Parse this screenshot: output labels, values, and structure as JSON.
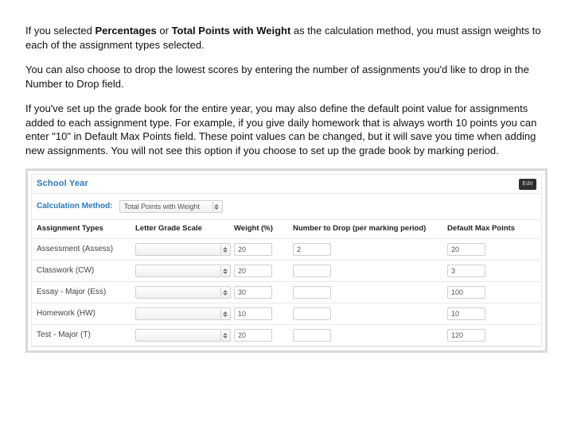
{
  "intro": {
    "p1_a": "If you selected ",
    "p1_b": "Percentages",
    "p1_c": " or ",
    "p1_d": "Total Points with Weight",
    "p1_e": " as the calculation method, you must assign weights to each of the assignment types selected.",
    "p2": "You can also choose to drop the lowest scores by entering the number of assignments you'd like to drop in the Number to Drop field.",
    "p3": "If you've set up the grade book for the entire year, you may also define the default point value for assignments added to each assignment type. For example, if you give daily homework that is always worth 10 points you can enter \"10\" in Default Max Points field. These point values can be changed, but it will save you time when adding new assignments. You will not see this option if you choose to set up the grade book by marking period."
  },
  "panel": {
    "title": "School Year",
    "edit": "Edit",
    "method_label": "Calculation Method:",
    "method_value": "Total Points with Weight",
    "headers": {
      "types": "Assignment Types",
      "scale": "Letter Grade Scale",
      "weight": "Weight (%)",
      "drop": "Number to Drop (per marking period)",
      "default": "Default Max Points"
    },
    "rows": [
      {
        "type": "Assessment (Assess)",
        "scale": "",
        "weight": "20",
        "drop": "2",
        "default": "20"
      },
      {
        "type": "Classwork (CW)",
        "scale": "",
        "weight": "20",
        "drop": "",
        "default": "3"
      },
      {
        "type": "Essay - Major (Ess)",
        "scale": "",
        "weight": "30",
        "drop": "",
        "default": "100"
      },
      {
        "type": "Homework (HW)",
        "scale": "",
        "weight": "10",
        "drop": "",
        "default": "10"
      },
      {
        "type": "Test - Major (T)",
        "scale": "",
        "weight": "20",
        "drop": "",
        "default": "120"
      }
    ]
  }
}
